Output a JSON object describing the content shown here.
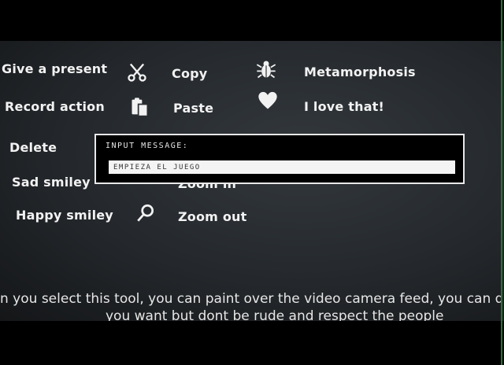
{
  "menu": {
    "col1": [
      "Give a present",
      "Record action",
      "Delete",
      "Sad smiley",
      "Happy smiley"
    ],
    "col2": [
      "Copy",
      "Paste",
      "Zoom in",
      "Zoom out"
    ],
    "col3": [
      "Metamorphosis",
      "I love that!"
    ]
  },
  "icons": [
    "scissors-icon",
    "paste-icon",
    "zoom-in-icon",
    "magnifier-icon",
    "bug-icon",
    "heart-icon"
  ],
  "dialog": {
    "title": "INPUT MESSAGE:",
    "value": "EMPIEZA EL JUEGO"
  },
  "caption": {
    "line1": "n you select this tool, you can paint over the video camera feed, you can dr",
    "line2": "you want but dont be rude and respect the people"
  }
}
